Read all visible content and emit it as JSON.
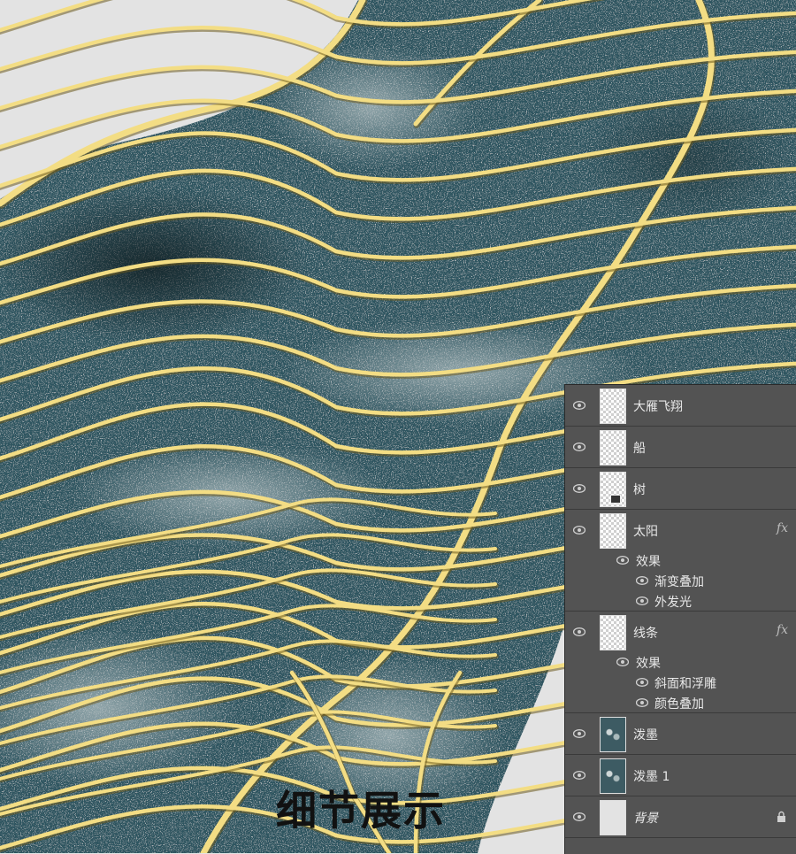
{
  "caption": "细节展示",
  "layers_panel": {
    "layers": [
      {
        "name": "大雁飞翔"
      },
      {
        "name": "船"
      },
      {
        "name": "树"
      },
      {
        "name": "太阳",
        "fx": "fx",
        "effects_label": "效果",
        "effects": [
          "渐变叠加",
          "外发光"
        ]
      },
      {
        "name": "线条",
        "fx": "fx",
        "effects_label": "效果",
        "effects": [
          "斜面和浮雕",
          "颜色叠加"
        ]
      },
      {
        "name": "泼墨"
      },
      {
        "name": "泼墨 1"
      },
      {
        "name": "背景"
      }
    ]
  },
  "colors": {
    "ink": "#2f5560",
    "gold_line": "#f3dd84",
    "panel_bg": "#535353",
    "canvas_bg": "#e3e3e3"
  }
}
